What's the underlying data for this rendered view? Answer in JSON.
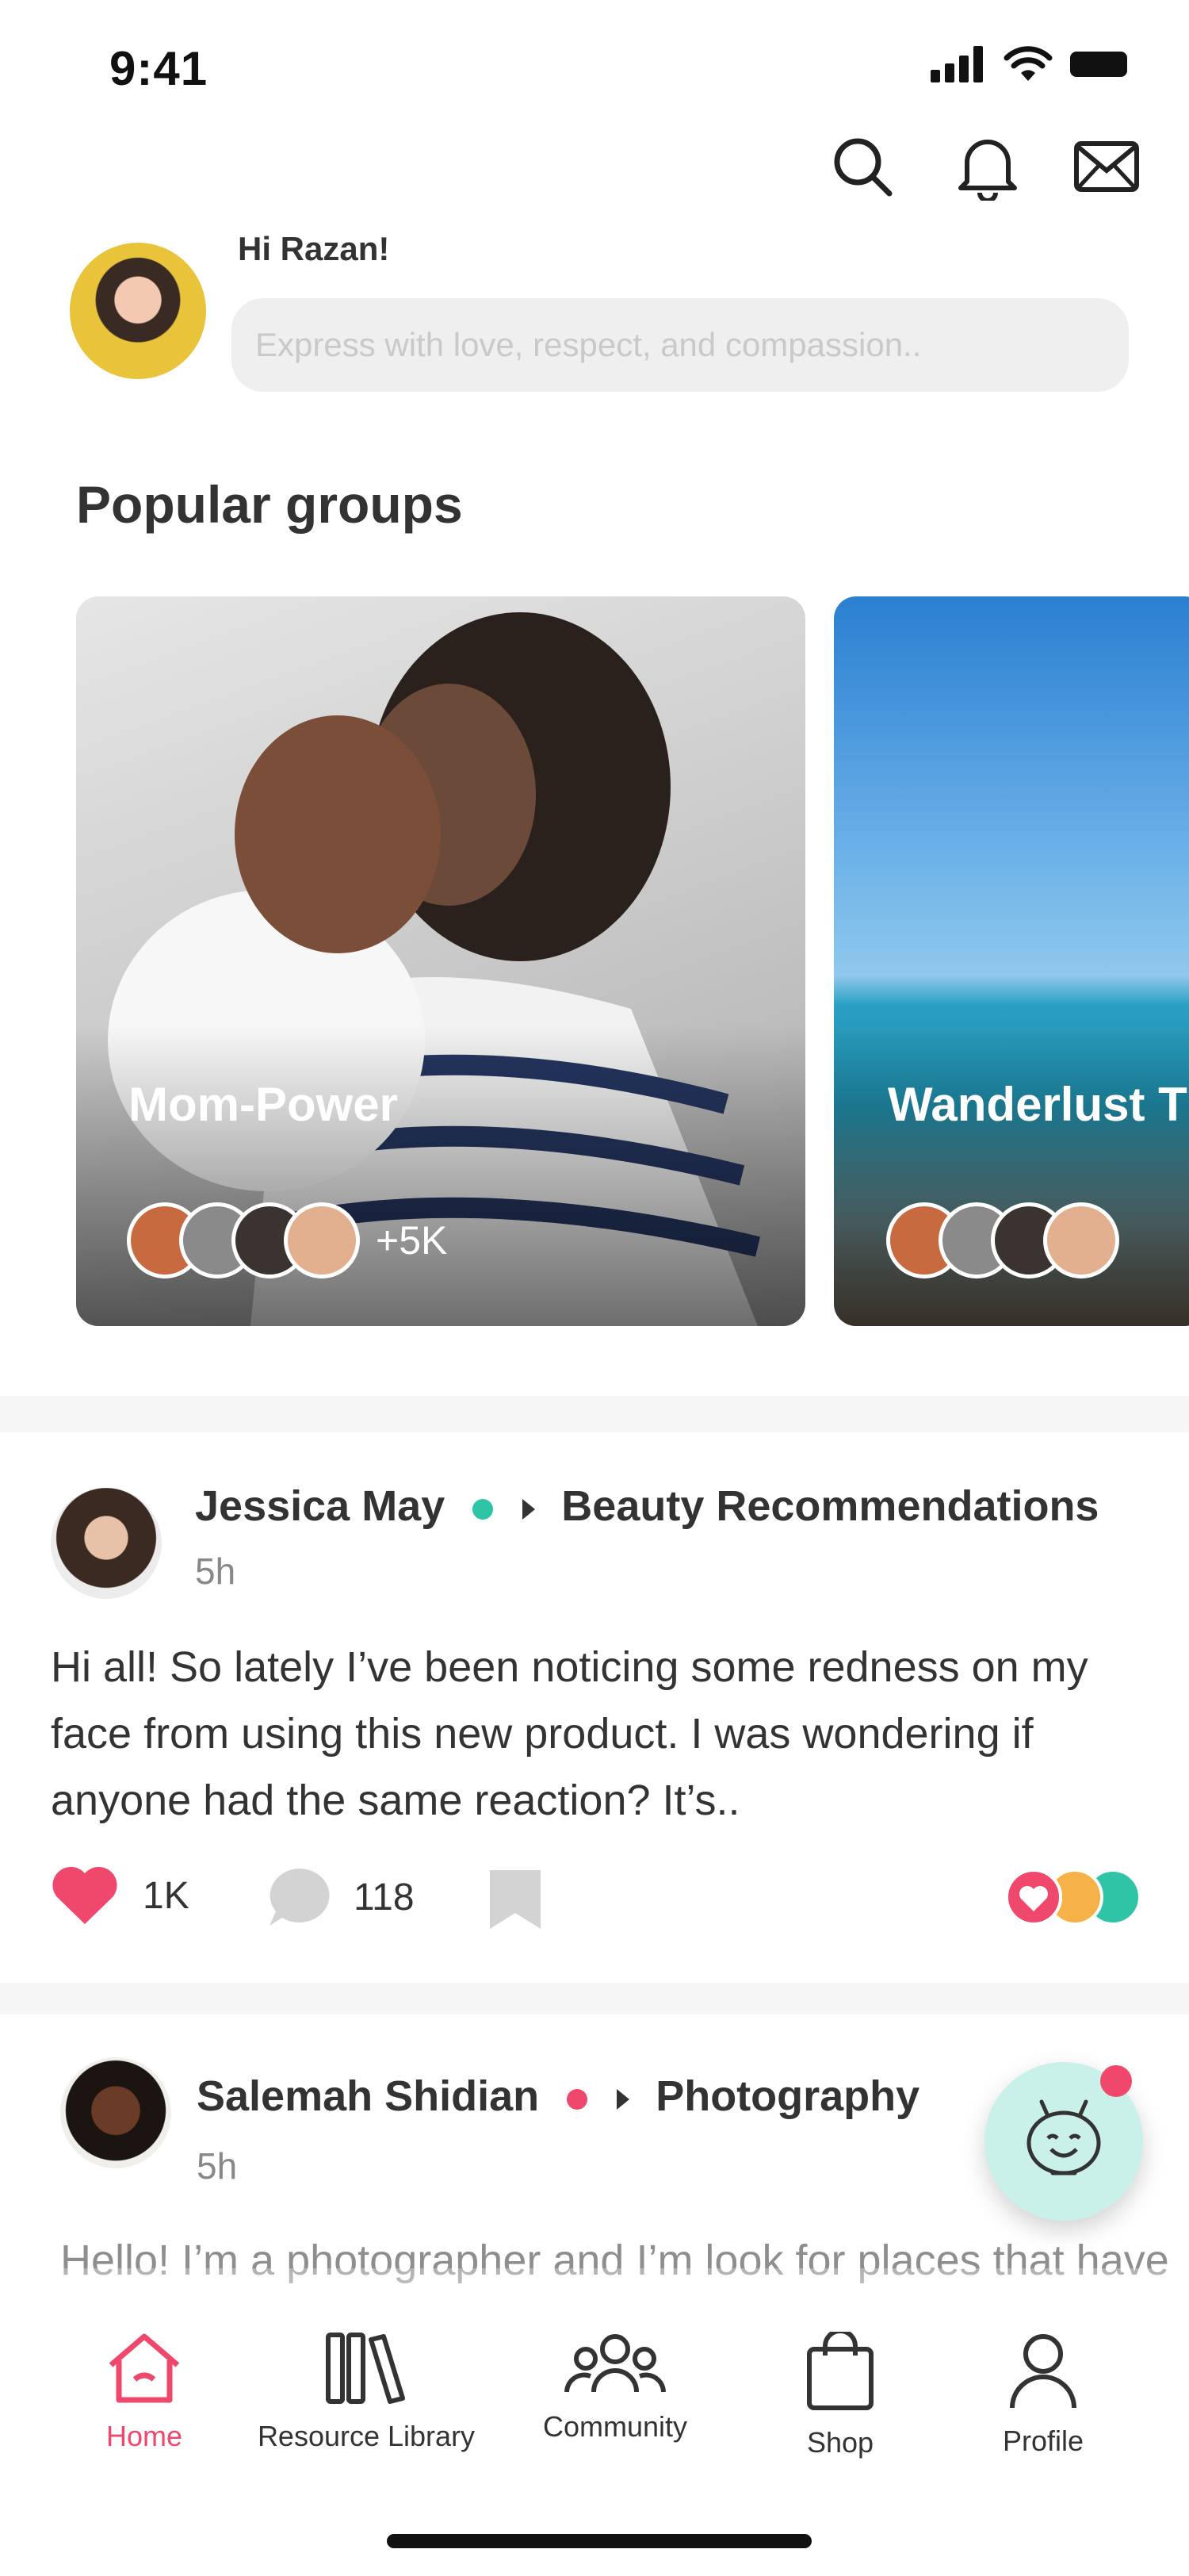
{
  "status_bar": {
    "time": "9:41"
  },
  "header": {
    "greeting": "Hi Razan!",
    "compose_placeholder": "Express with love, respect, and compassion..",
    "actions": [
      "search-icon",
      "bell-icon",
      "mail-icon"
    ]
  },
  "popular_groups": {
    "title": "Popular groups",
    "groups": [
      {
        "name": "Mom-Power",
        "member_count": "+5K"
      },
      {
        "name": "Wanderlust T"
      }
    ]
  },
  "posts": [
    {
      "author": "Jessica May",
      "group": "Beauty Recommendations",
      "time": "5h",
      "body": "Hi all! So lately I’ve been noticing some redness on my face from using this new product. I was wondering if anyone had the same reaction? It’s..",
      "likes": "1K",
      "comments": "118",
      "group_dot_color": "#2ec4a6"
    },
    {
      "author": "Salemah Shidian",
      "group": "Photography",
      "time": "5h",
      "body": "Hello! I’m a photographer and I’m look for places that have this type of aesthetic around the Lower Mainland region. Thanks so much in advance!",
      "group_dot_color": "#f0476d"
    }
  ],
  "bottom_nav": [
    {
      "label": "Home",
      "icon": "home-icon",
      "active": true
    },
    {
      "label": "Resource Library",
      "icon": "books-icon"
    },
    {
      "label": "Community",
      "icon": "people-icon"
    },
    {
      "label": "Shop",
      "icon": "shopping-bag-icon"
    },
    {
      "label": "Profile",
      "icon": "person-icon"
    }
  ],
  "colors": {
    "accent": "#f0476d",
    "teal": "#2ec4a6",
    "muted": "#888888"
  }
}
